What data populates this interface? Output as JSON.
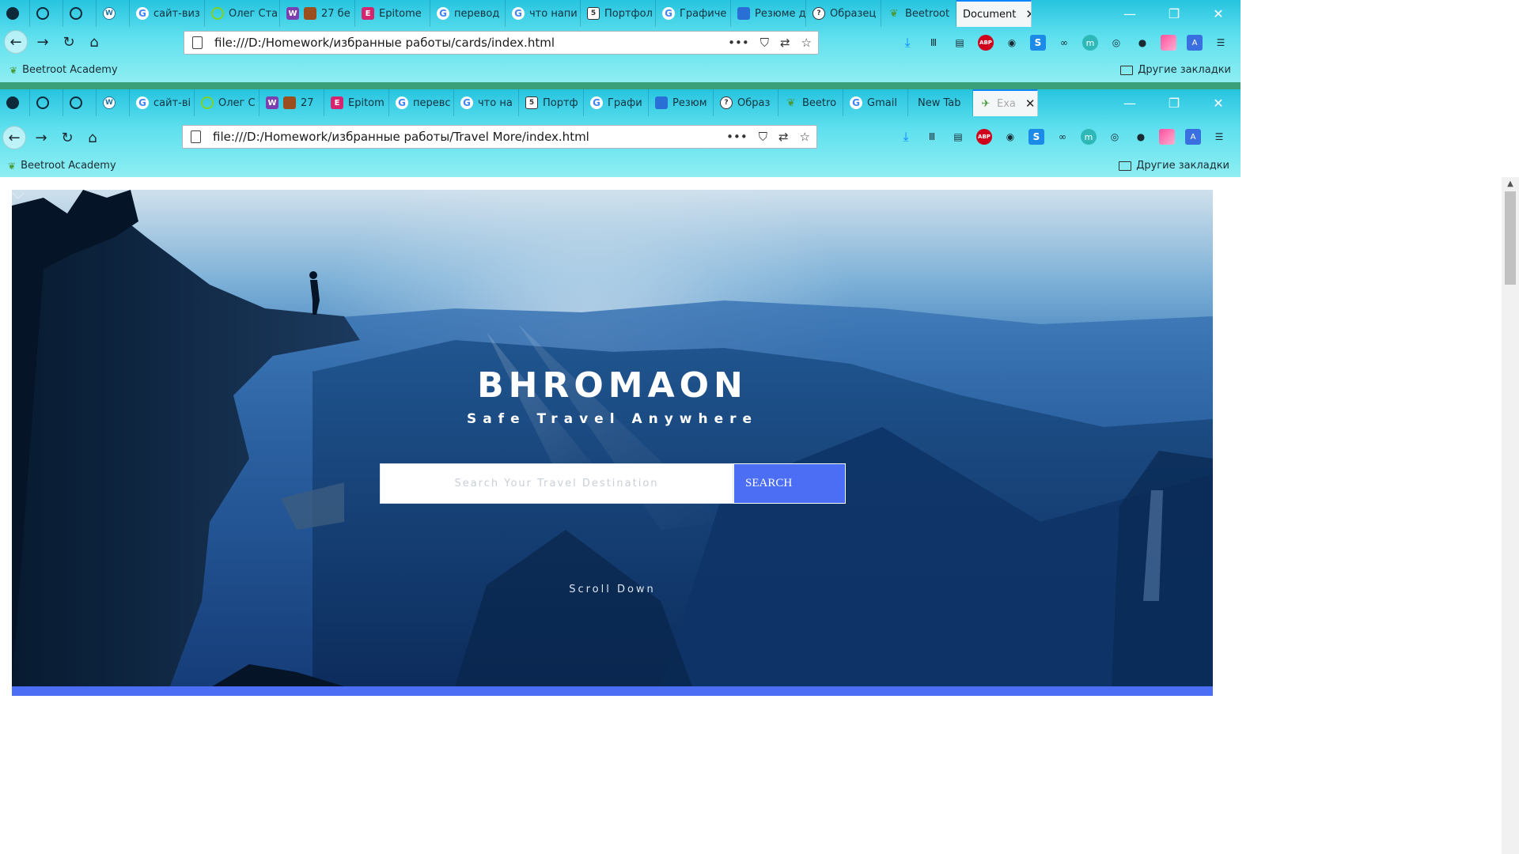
{
  "window_top": {
    "tabs": [
      {
        "label": "",
        "icon": "app-icon"
      },
      {
        "label": "",
        "icon": "globe-ext-icon"
      },
      {
        "label": "",
        "icon": "globe-icon"
      },
      {
        "label": "",
        "icon": "wordpress-icon"
      },
      {
        "label": "сайт-виз",
        "icon": "google-icon"
      },
      {
        "label": "Олег Ста",
        "icon": "ring-icon"
      },
      {
        "label": "27 бе",
        "icon": "box-icon"
      },
      {
        "label": "Epitome",
        "icon": "epitome-icon"
      },
      {
        "label": "перевод",
        "icon": "google-icon"
      },
      {
        "label": "что напи",
        "icon": "google-icon"
      },
      {
        "label": "Портфол",
        "icon": "shield-icon"
      },
      {
        "label": "Графиче",
        "icon": "google-icon"
      },
      {
        "label": "Резюме д",
        "icon": "resume-icon"
      },
      {
        "label": "Образец",
        "icon": "question-icon"
      },
      {
        "label": "Beetroot",
        "icon": "beetroot-icon"
      },
      {
        "label": "Document",
        "icon": ""
      }
    ],
    "url": "file:///D:/Homework/избранные работы/cards/index.html",
    "bookmark": "Beetroot Academy",
    "other_bookmarks": "Другие закладки"
  },
  "window_bottom": {
    "tabs": [
      {
        "label": "",
        "icon": "app-icon"
      },
      {
        "label": "",
        "icon": "globe-ext-icon"
      },
      {
        "label": "",
        "icon": "globe-icon"
      },
      {
        "label": "",
        "icon": "wordpress-icon"
      },
      {
        "label": "сайт-ві",
        "icon": "google-icon"
      },
      {
        "label": "Олег С",
        "icon": "ring-icon"
      },
      {
        "label": "27",
        "icon": "box-icon"
      },
      {
        "label": "Epitom",
        "icon": "epitome-icon"
      },
      {
        "label": "перевс",
        "icon": "google-icon"
      },
      {
        "label": "что на",
        "icon": "google-icon"
      },
      {
        "label": "Портф",
        "icon": "shield-icon"
      },
      {
        "label": "Графи",
        "icon": "google-icon"
      },
      {
        "label": "Резюм",
        "icon": "resume-icon"
      },
      {
        "label": "Образ",
        "icon": "question-icon"
      },
      {
        "label": "Beetro",
        "icon": "beetroot-icon"
      },
      {
        "label": "Gmail",
        "icon": "google-icon"
      },
      {
        "label": "New Tab",
        "icon": ""
      },
      {
        "label": "Exa",
        "icon": "page-icon"
      }
    ],
    "url": "file:///D:/Homework/избранные работы/Travel More/index.html",
    "bookmark": "Beetroot Academy",
    "other_bookmarks": "Другие закладки"
  },
  "hero": {
    "brand": "BHROMAON",
    "tagline": "Safe Travel Anywhere",
    "search_placeholder": "Search Your Travel Destination",
    "search_button": "SEARCH",
    "scroll_label": "Scroll Down"
  },
  "colors": {
    "accent": "#4b6ef5",
    "hero_dark": "#0b2f62",
    "browser_theme": "#27c4e0"
  }
}
